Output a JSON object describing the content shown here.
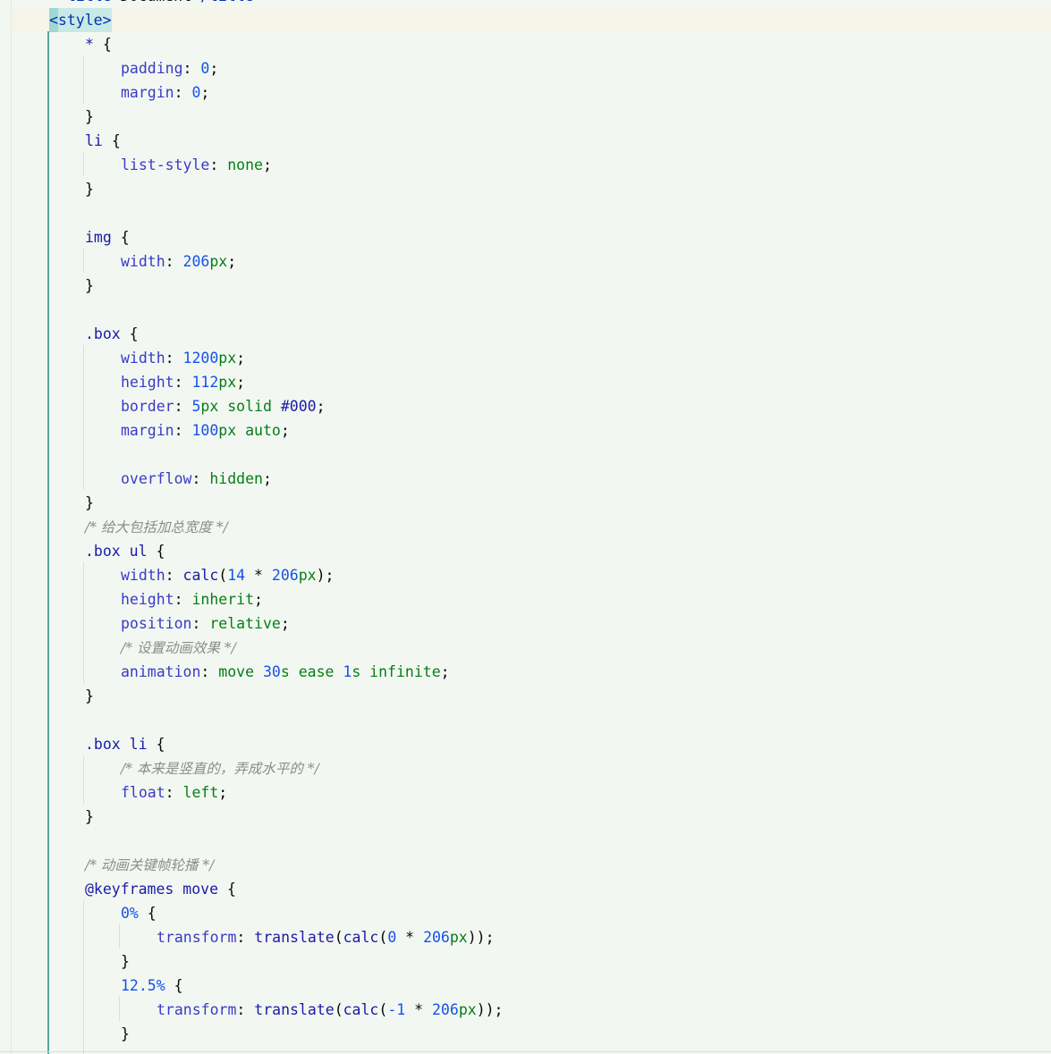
{
  "editor": {
    "lines": [
      [
        [
          "t",
          "<title>"
        ],
        [
          "x",
          "Document"
        ],
        [
          "t",
          "</title>"
        ]
      ],
      [
        [
          "tag",
          "<style>"
        ]
      ],
      [
        [
          "s",
          "* "
        ],
        [
          "x",
          "{"
        ]
      ],
      [
        [
          "p",
          "padding"
        ],
        [
          "x",
          ": "
        ],
        [
          "n",
          "0"
        ],
        [
          "x",
          ";"
        ]
      ],
      [
        [
          "p",
          "margin"
        ],
        [
          "x",
          ": "
        ],
        [
          "n",
          "0"
        ],
        [
          "x",
          ";"
        ]
      ],
      [
        [
          "x",
          "}"
        ]
      ],
      [
        [
          "s",
          "li "
        ],
        [
          "x",
          "{"
        ]
      ],
      [
        [
          "p",
          "list-style"
        ],
        [
          "x",
          ": "
        ],
        [
          "k",
          "none"
        ],
        [
          "x",
          ";"
        ]
      ],
      [
        [
          "x",
          "}"
        ]
      ],
      [],
      [
        [
          "s",
          "img "
        ],
        [
          "x",
          "{"
        ]
      ],
      [
        [
          "p",
          "width"
        ],
        [
          "x",
          ": "
        ],
        [
          "n",
          "206"
        ],
        [
          "u",
          "px"
        ],
        [
          "x",
          ";"
        ]
      ],
      [
        [
          "x",
          "}"
        ]
      ],
      [],
      [
        [
          "s",
          ".box "
        ],
        [
          "x",
          "{"
        ]
      ],
      [
        [
          "p",
          "width"
        ],
        [
          "x",
          ": "
        ],
        [
          "n",
          "1200"
        ],
        [
          "u",
          "px"
        ],
        [
          "x",
          ";"
        ]
      ],
      [
        [
          "p",
          "height"
        ],
        [
          "x",
          ": "
        ],
        [
          "n",
          "112"
        ],
        [
          "u",
          "px"
        ],
        [
          "x",
          ";"
        ]
      ],
      [
        [
          "p",
          "border"
        ],
        [
          "x",
          ": "
        ],
        [
          "n",
          "5"
        ],
        [
          "u",
          "px"
        ],
        [
          "k",
          " solid "
        ],
        [
          "s",
          "#000"
        ],
        [
          "x",
          ";"
        ]
      ],
      [
        [
          "p",
          "margin"
        ],
        [
          "x",
          ": "
        ],
        [
          "n",
          "100"
        ],
        [
          "u",
          "px"
        ],
        [
          "k",
          " auto"
        ],
        [
          "x",
          ";"
        ]
      ],
      [],
      [
        [
          "p",
          "overflow"
        ],
        [
          "x",
          ": "
        ],
        [
          "k",
          "hidden"
        ],
        [
          "x",
          ";"
        ]
      ],
      [
        [
          "x",
          "}"
        ]
      ],
      [
        [
          "c",
          "/* 给大包括加总宽度 */"
        ]
      ],
      [
        [
          "s",
          ".box ul "
        ],
        [
          "x",
          "{"
        ]
      ],
      [
        [
          "p",
          "width"
        ],
        [
          "x",
          ": "
        ],
        [
          "s",
          "calc"
        ],
        [
          "x",
          "("
        ],
        [
          "n",
          "14"
        ],
        [
          "x",
          " * "
        ],
        [
          "n",
          "206"
        ],
        [
          "u",
          "px"
        ],
        [
          "x",
          ");"
        ]
      ],
      [
        [
          "p",
          "height"
        ],
        [
          "x",
          ": "
        ],
        [
          "k",
          "inherit"
        ],
        [
          "x",
          ";"
        ]
      ],
      [
        [
          "p",
          "position"
        ],
        [
          "x",
          ": "
        ],
        [
          "k",
          "relative"
        ],
        [
          "x",
          ";"
        ]
      ],
      [
        [
          "c",
          "/* 设置动画效果 */"
        ]
      ],
      [
        [
          "p",
          "animation"
        ],
        [
          "x",
          ": "
        ],
        [
          "k",
          "move "
        ],
        [
          "n",
          "30"
        ],
        [
          "k",
          "s ease "
        ],
        [
          "n",
          "1"
        ],
        [
          "k",
          "s infinite"
        ],
        [
          "x",
          ";"
        ]
      ],
      [
        [
          "x",
          "}"
        ]
      ],
      [],
      [
        [
          "s",
          ".box li "
        ],
        [
          "x",
          "{"
        ]
      ],
      [
        [
          "c",
          "/* 本来是竖直的，弄成水平的 */"
        ]
      ],
      [
        [
          "p",
          "float"
        ],
        [
          "x",
          ": "
        ],
        [
          "k",
          "left"
        ],
        [
          "x",
          ";"
        ]
      ],
      [
        [
          "x",
          "}"
        ]
      ],
      [],
      [
        [
          "c",
          "/* 动画关键帧轮播 */"
        ]
      ],
      [
        [
          "s",
          "@keyframes move "
        ],
        [
          "x",
          "{"
        ]
      ],
      [
        [
          "n",
          "0%"
        ],
        [
          "x",
          " {"
        ]
      ],
      [
        [
          "p",
          "transform"
        ],
        [
          "x",
          ": "
        ],
        [
          "s",
          "translate"
        ],
        [
          "x",
          "("
        ],
        [
          "s",
          "calc"
        ],
        [
          "x",
          "("
        ],
        [
          "n",
          "0"
        ],
        [
          "x",
          " * "
        ],
        [
          "n",
          "206"
        ],
        [
          "u",
          "px"
        ],
        [
          "x",
          "));"
        ]
      ],
      [
        [
          "x",
          "}"
        ]
      ],
      [
        [
          "n",
          "12.5%"
        ],
        [
          "x",
          " {"
        ]
      ],
      [
        [
          "p",
          "transform"
        ],
        [
          "x",
          ": "
        ],
        [
          "s",
          "translate"
        ],
        [
          "x",
          "("
        ],
        [
          "s",
          "calc"
        ],
        [
          "x",
          "("
        ],
        [
          "n",
          "-1"
        ],
        [
          "x",
          " * "
        ],
        [
          "n",
          "206"
        ],
        [
          "u",
          "px"
        ],
        [
          "x",
          "));"
        ]
      ],
      [
        [
          "x",
          "}"
        ]
      ]
    ]
  }
}
